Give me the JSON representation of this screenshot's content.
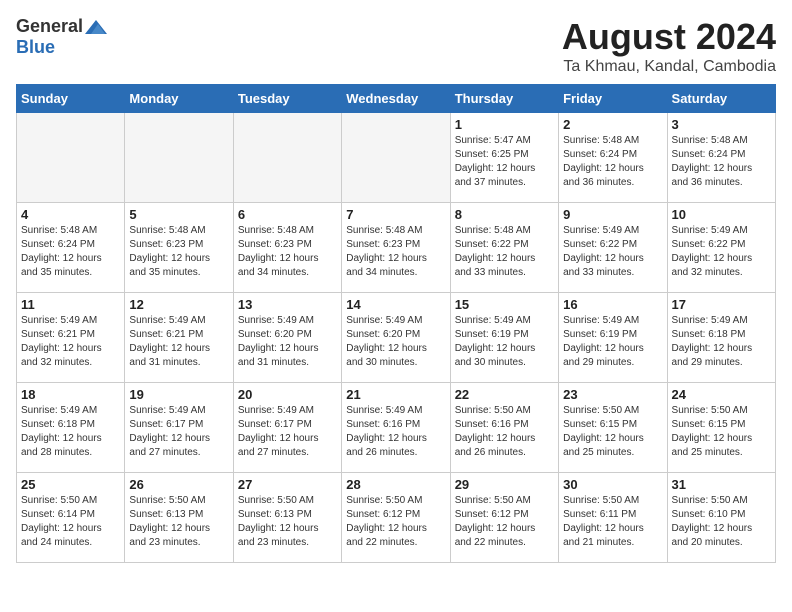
{
  "header": {
    "logo_general": "General",
    "logo_blue": "Blue",
    "month_title": "August 2024",
    "location": "Ta Khmau, Kandal, Cambodia"
  },
  "days_of_week": [
    "Sunday",
    "Monday",
    "Tuesday",
    "Wednesday",
    "Thursday",
    "Friday",
    "Saturday"
  ],
  "weeks": [
    [
      {
        "day": "",
        "empty": true
      },
      {
        "day": "",
        "empty": true
      },
      {
        "day": "",
        "empty": true
      },
      {
        "day": "",
        "empty": true
      },
      {
        "day": "1",
        "sunrise": "5:47 AM",
        "sunset": "6:25 PM",
        "daylight": "12 hours and 37 minutes."
      },
      {
        "day": "2",
        "sunrise": "5:48 AM",
        "sunset": "6:24 PM",
        "daylight": "12 hours and 36 minutes."
      },
      {
        "day": "3",
        "sunrise": "5:48 AM",
        "sunset": "6:24 PM",
        "daylight": "12 hours and 36 minutes."
      }
    ],
    [
      {
        "day": "4",
        "sunrise": "5:48 AM",
        "sunset": "6:24 PM",
        "daylight": "12 hours and 35 minutes."
      },
      {
        "day": "5",
        "sunrise": "5:48 AM",
        "sunset": "6:23 PM",
        "daylight": "12 hours and 35 minutes."
      },
      {
        "day": "6",
        "sunrise": "5:48 AM",
        "sunset": "6:23 PM",
        "daylight": "12 hours and 34 minutes."
      },
      {
        "day": "7",
        "sunrise": "5:48 AM",
        "sunset": "6:23 PM",
        "daylight": "12 hours and 34 minutes."
      },
      {
        "day": "8",
        "sunrise": "5:48 AM",
        "sunset": "6:22 PM",
        "daylight": "12 hours and 33 minutes."
      },
      {
        "day": "9",
        "sunrise": "5:49 AM",
        "sunset": "6:22 PM",
        "daylight": "12 hours and 33 minutes."
      },
      {
        "day": "10",
        "sunrise": "5:49 AM",
        "sunset": "6:22 PM",
        "daylight": "12 hours and 32 minutes."
      }
    ],
    [
      {
        "day": "11",
        "sunrise": "5:49 AM",
        "sunset": "6:21 PM",
        "daylight": "12 hours and 32 minutes."
      },
      {
        "day": "12",
        "sunrise": "5:49 AM",
        "sunset": "6:21 PM",
        "daylight": "12 hours and 31 minutes."
      },
      {
        "day": "13",
        "sunrise": "5:49 AM",
        "sunset": "6:20 PM",
        "daylight": "12 hours and 31 minutes."
      },
      {
        "day": "14",
        "sunrise": "5:49 AM",
        "sunset": "6:20 PM",
        "daylight": "12 hours and 30 minutes."
      },
      {
        "day": "15",
        "sunrise": "5:49 AM",
        "sunset": "6:19 PM",
        "daylight": "12 hours and 30 minutes."
      },
      {
        "day": "16",
        "sunrise": "5:49 AM",
        "sunset": "6:19 PM",
        "daylight": "12 hours and 29 minutes."
      },
      {
        "day": "17",
        "sunrise": "5:49 AM",
        "sunset": "6:18 PM",
        "daylight": "12 hours and 29 minutes."
      }
    ],
    [
      {
        "day": "18",
        "sunrise": "5:49 AM",
        "sunset": "6:18 PM",
        "daylight": "12 hours and 28 minutes."
      },
      {
        "day": "19",
        "sunrise": "5:49 AM",
        "sunset": "6:17 PM",
        "daylight": "12 hours and 27 minutes."
      },
      {
        "day": "20",
        "sunrise": "5:49 AM",
        "sunset": "6:17 PM",
        "daylight": "12 hours and 27 minutes."
      },
      {
        "day": "21",
        "sunrise": "5:49 AM",
        "sunset": "6:16 PM",
        "daylight": "12 hours and 26 minutes."
      },
      {
        "day": "22",
        "sunrise": "5:50 AM",
        "sunset": "6:16 PM",
        "daylight": "12 hours and 26 minutes."
      },
      {
        "day": "23",
        "sunrise": "5:50 AM",
        "sunset": "6:15 PM",
        "daylight": "12 hours and 25 minutes."
      },
      {
        "day": "24",
        "sunrise": "5:50 AM",
        "sunset": "6:15 PM",
        "daylight": "12 hours and 25 minutes."
      }
    ],
    [
      {
        "day": "25",
        "sunrise": "5:50 AM",
        "sunset": "6:14 PM",
        "daylight": "12 hours and 24 minutes."
      },
      {
        "day": "26",
        "sunrise": "5:50 AM",
        "sunset": "6:13 PM",
        "daylight": "12 hours and 23 minutes."
      },
      {
        "day": "27",
        "sunrise": "5:50 AM",
        "sunset": "6:13 PM",
        "daylight": "12 hours and 23 minutes."
      },
      {
        "day": "28",
        "sunrise": "5:50 AM",
        "sunset": "6:12 PM",
        "daylight": "12 hours and 22 minutes."
      },
      {
        "day": "29",
        "sunrise": "5:50 AM",
        "sunset": "6:12 PM",
        "daylight": "12 hours and 22 minutes."
      },
      {
        "day": "30",
        "sunrise": "5:50 AM",
        "sunset": "6:11 PM",
        "daylight": "12 hours and 21 minutes."
      },
      {
        "day": "31",
        "sunrise": "5:50 AM",
        "sunset": "6:10 PM",
        "daylight": "12 hours and 20 minutes."
      }
    ]
  ]
}
